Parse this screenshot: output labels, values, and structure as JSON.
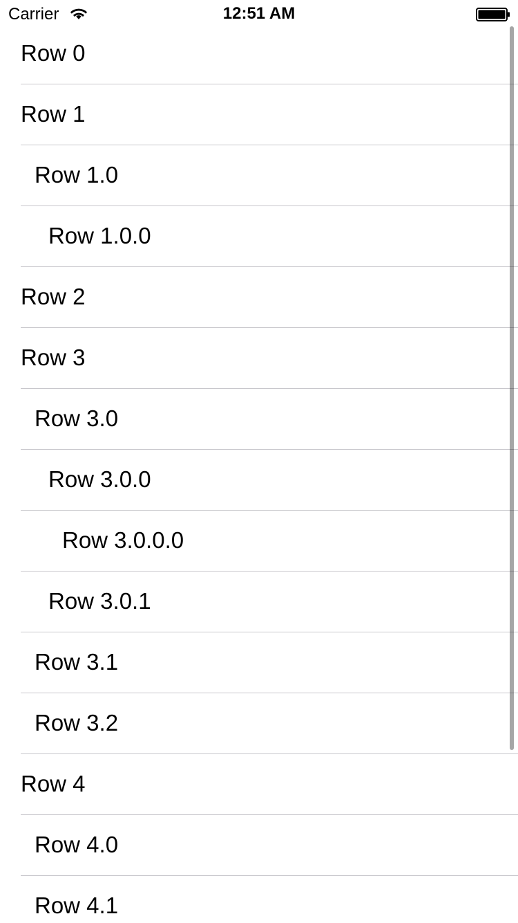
{
  "status_bar": {
    "carrier": "Carrier",
    "time": "12:51 AM",
    "wifi_icon": "wifi-icon",
    "battery_icon": "battery-icon"
  },
  "table": {
    "separator_color": "#c8c7cc",
    "rows": [
      {
        "label": "Row 0",
        "level": 0
      },
      {
        "label": "Row 1",
        "level": 0
      },
      {
        "label": "Row 1.0",
        "level": 1
      },
      {
        "label": "Row 1.0.0",
        "level": 2
      },
      {
        "label": "Row 2",
        "level": 0
      },
      {
        "label": "Row 3",
        "level": 0
      },
      {
        "label": "Row 3.0",
        "level": 1
      },
      {
        "label": "Row 3.0.0",
        "level": 2
      },
      {
        "label": "Row 3.0.0.0",
        "level": 3
      },
      {
        "label": "Row 3.0.1",
        "level": 2
      },
      {
        "label": "Row 3.1",
        "level": 1
      },
      {
        "label": "Row 3.2",
        "level": 1
      },
      {
        "label": "Row 4",
        "level": 0
      },
      {
        "label": "Row 4.0",
        "level": 1
      },
      {
        "label": "Row 4.1",
        "level": 1
      }
    ]
  }
}
